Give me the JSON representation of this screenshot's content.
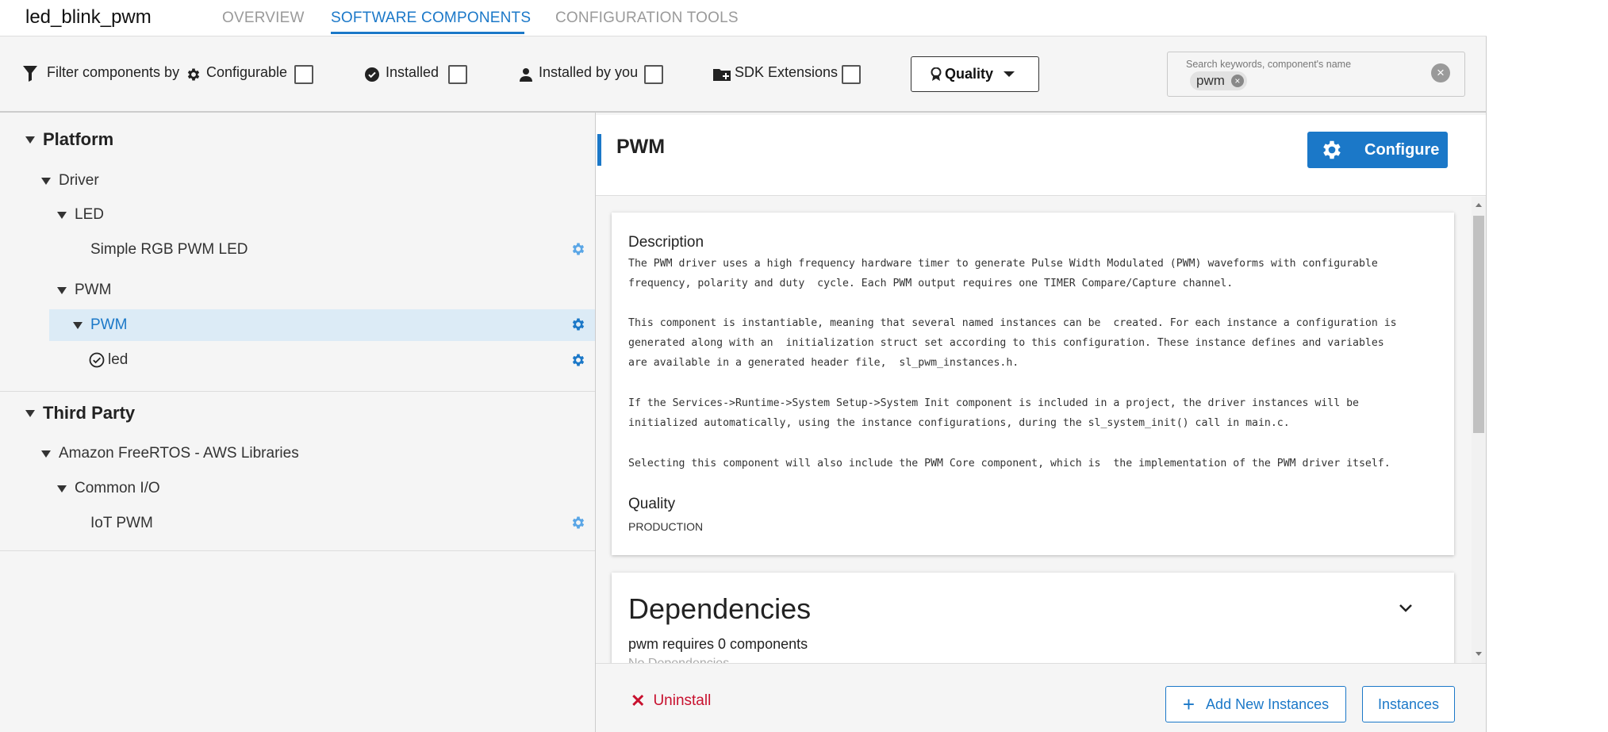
{
  "header": {
    "project_name": "led_blink_pwm",
    "tabs": [
      {
        "label": "OVERVIEW",
        "active": false
      },
      {
        "label": "SOFTWARE COMPONENTS",
        "active": true
      },
      {
        "label": "CONFIGURATION TOOLS",
        "active": false
      }
    ]
  },
  "filters": {
    "prefix": "Filter components by",
    "items": [
      {
        "label": "Configurable",
        "icon": "gear-icon",
        "checked": false
      },
      {
        "label": "Installed",
        "icon": "check-circle-icon",
        "checked": false
      },
      {
        "label": "Installed by you",
        "icon": "person-icon",
        "checked": false
      },
      {
        "label": "SDK Extensions",
        "icon": "folder-plus-icon",
        "checked": false
      }
    ],
    "quality_label": "Quality",
    "search": {
      "placeholder": "Search keywords, component's name",
      "chip": "pwm"
    }
  },
  "tree": {
    "rows": [
      {
        "label": "Platform",
        "level": 0,
        "caret": true,
        "section": true
      },
      {
        "label": "Driver",
        "level": 1,
        "caret": true
      },
      {
        "label": "LED",
        "level": 2,
        "caret": true
      },
      {
        "label": "Simple RGB PWM LED",
        "level": 3,
        "caret": false,
        "configurable": true
      },
      {
        "label": "PWM",
        "level": 2,
        "caret": true
      },
      {
        "label": "PWM",
        "level": 2,
        "caret": true,
        "selected": true,
        "configurable": true
      },
      {
        "label": "led",
        "level": 3,
        "caret": false,
        "installed": true,
        "configurable": true
      },
      {
        "label": "Third Party",
        "level": 0,
        "caret": true,
        "section": true
      },
      {
        "label": "Amazon FreeRTOS - AWS Libraries",
        "level": 1,
        "caret": true
      },
      {
        "label": "Common I/O",
        "level": 2,
        "caret": true
      },
      {
        "label": "IoT PWM",
        "level": 3,
        "caret": false,
        "configurable": true
      }
    ]
  },
  "component": {
    "title": "PWM",
    "configure_label": "Configure",
    "description_heading": "Description",
    "description": [
      "The PWM driver uses a high frequency hardware timer to generate Pulse Width Modulated (PWM) waveforms with configurable\nfrequency, polarity and duty  cycle. Each PWM output requires one TIMER Compare/Capture channel.",
      "This component is instantiable, meaning that several named instances can be  created. For each instance a configuration is\ngenerated along with an  initialization struct set according to this configuration. These instance defines and variables\nare available in a generated header file,  sl_pwm_instances.h.",
      "If the Services->Runtime->System Setup->System Init component is included in a project, the driver instances will be\ninitialized automatically, using the instance configurations, during the sl_system_init() call in main.c.",
      "Selecting this component will also include the PWM Core component, which is  the implementation of the PWM driver itself."
    ],
    "quality_heading": "Quality",
    "quality_value": "PRODUCTION",
    "dependencies_heading": "Dependencies",
    "dependencies_summary": "pwm requires 0 components",
    "dependencies_none": "No Dependencies"
  },
  "footer": {
    "uninstall_label": "Uninstall",
    "add_instances_label": "Add New Instances",
    "instances_label": "Instances"
  },
  "colors": {
    "accent": "#1b78c8",
    "danger": "#c8102e",
    "selected_row": "#dcebf6"
  }
}
